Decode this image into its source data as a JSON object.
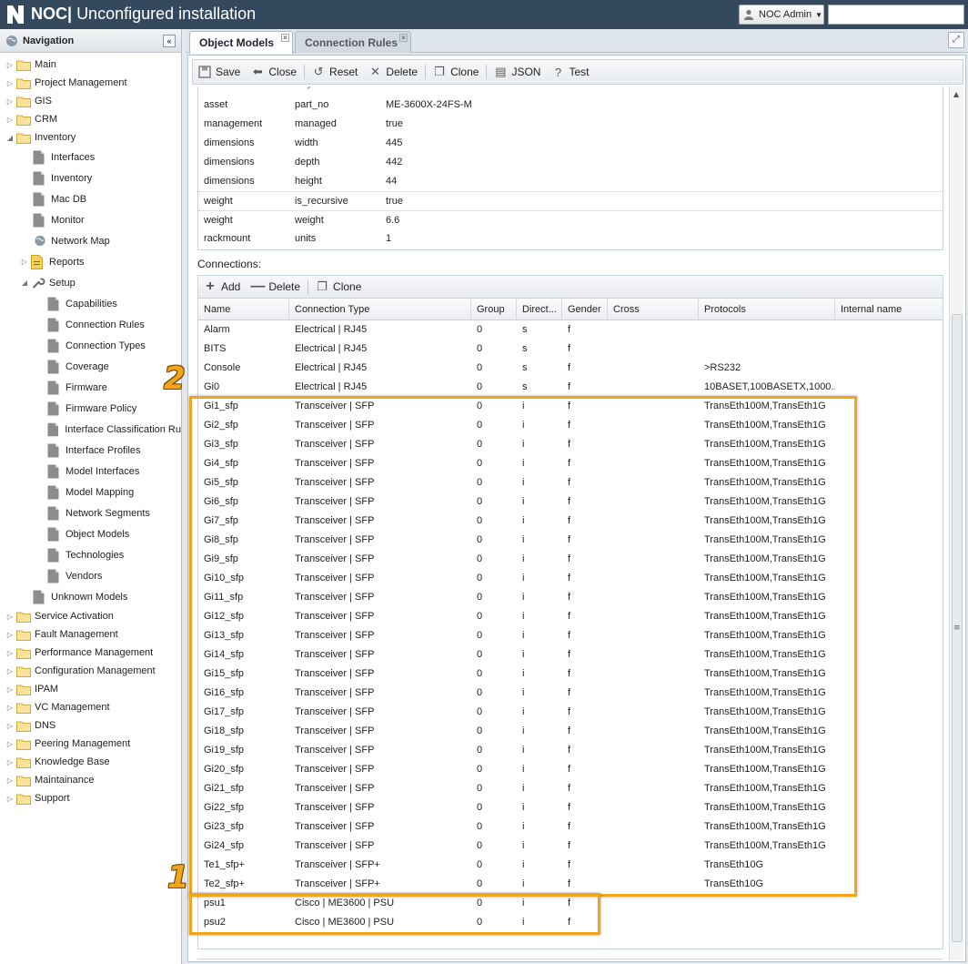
{
  "app": {
    "title_prefix": "NOC|",
    "title": "Unconfigured installation",
    "user_label": "NOC Admin",
    "search_value": ""
  },
  "navigation": {
    "header": "Navigation",
    "items": [
      {
        "label": "Main",
        "level": 0,
        "type": "folder",
        "state": "collapsed"
      },
      {
        "label": "Project Management",
        "level": 0,
        "type": "folder",
        "state": "collapsed"
      },
      {
        "label": "GIS",
        "level": 0,
        "type": "folder",
        "state": "collapsed"
      },
      {
        "label": "CRM",
        "level": 0,
        "type": "folder",
        "state": "collapsed"
      },
      {
        "label": "Inventory",
        "level": 0,
        "type": "folder",
        "state": "expanded"
      },
      {
        "label": "Interfaces",
        "level": 1,
        "type": "page"
      },
      {
        "label": "Inventory",
        "level": 1,
        "type": "page"
      },
      {
        "label": "Mac DB",
        "level": 1,
        "type": "page"
      },
      {
        "label": "Monitor",
        "level": 1,
        "type": "page"
      },
      {
        "label": "Network Map",
        "level": 1,
        "type": "globe"
      },
      {
        "label": "Reports",
        "level": 1,
        "type": "report",
        "state": "collapsed"
      },
      {
        "label": "Setup",
        "level": 1,
        "type": "wrench",
        "state": "expanded"
      },
      {
        "label": "Capabilities",
        "level": 2,
        "type": "page"
      },
      {
        "label": "Connection Rules",
        "level": 2,
        "type": "page"
      },
      {
        "label": "Connection Types",
        "level": 2,
        "type": "page"
      },
      {
        "label": "Coverage",
        "level": 2,
        "type": "page"
      },
      {
        "label": "Firmware",
        "level": 2,
        "type": "page"
      },
      {
        "label": "Firmware Policy",
        "level": 2,
        "type": "page"
      },
      {
        "label": "Interface Classification Ru",
        "level": 2,
        "type": "page"
      },
      {
        "label": "Interface Profiles",
        "level": 2,
        "type": "page"
      },
      {
        "label": "Model Interfaces",
        "level": 2,
        "type": "page"
      },
      {
        "label": "Model Mapping",
        "level": 2,
        "type": "page"
      },
      {
        "label": "Network Segments",
        "level": 2,
        "type": "page"
      },
      {
        "label": "Object Models",
        "level": 2,
        "type": "page"
      },
      {
        "label": "Technologies",
        "level": 2,
        "type": "page"
      },
      {
        "label": "Vendors",
        "level": 2,
        "type": "page"
      },
      {
        "label": "Unknown Models",
        "level": 1,
        "type": "page"
      },
      {
        "label": "Service Activation",
        "level": 0,
        "type": "folder",
        "state": "collapsed"
      },
      {
        "label": "Fault Management",
        "level": 0,
        "type": "folder",
        "state": "collapsed"
      },
      {
        "label": "Performance Management",
        "level": 0,
        "type": "folder",
        "state": "collapsed"
      },
      {
        "label": "Configuration Management",
        "level": 0,
        "type": "folder",
        "state": "collapsed"
      },
      {
        "label": "IPAM",
        "level": 0,
        "type": "folder",
        "state": "collapsed"
      },
      {
        "label": "VC Management",
        "level": 0,
        "type": "folder",
        "state": "collapsed"
      },
      {
        "label": "DNS",
        "level": 0,
        "type": "folder",
        "state": "collapsed"
      },
      {
        "label": "Peering Management",
        "level": 0,
        "type": "folder",
        "state": "collapsed"
      },
      {
        "label": "Knowledge Base",
        "level": 0,
        "type": "folder",
        "state": "collapsed"
      },
      {
        "label": "Maintainance",
        "level": 0,
        "type": "folder",
        "state": "collapsed"
      },
      {
        "label": "Support",
        "level": 0,
        "type": "folder",
        "state": "collapsed"
      }
    ]
  },
  "tabs": [
    {
      "label": "Object Models",
      "active": true
    },
    {
      "label": "Connection Rules",
      "active": false
    }
  ],
  "toolbar": {
    "save": "Save",
    "close": "Close",
    "reset": "Reset",
    "delete": "Delete",
    "clone": "Clone",
    "json": "JSON",
    "test": "Test"
  },
  "attributes": {
    "header_cut": [
      "Interface",
      "Key",
      "Value"
    ],
    "rows": [
      [
        "asset",
        "part_no",
        "ME-3600X-24FS-M"
      ],
      [
        "management",
        "managed",
        "true"
      ],
      [
        "dimensions",
        "width",
        "445"
      ],
      [
        "dimensions",
        "depth",
        "442"
      ],
      [
        "dimensions",
        "height",
        "44"
      ],
      [
        "weight",
        "is_recursive",
        "true"
      ],
      [
        "weight",
        "weight",
        "6.6"
      ],
      [
        "rackmount",
        "units",
        "1"
      ]
    ]
  },
  "connections": {
    "label": "Connections:",
    "toolbar": {
      "add": "Add",
      "delete": "Delete",
      "clone": "Clone"
    },
    "columns": [
      "Name",
      "Connection Type",
      "Group",
      "Direct...",
      "Gender",
      "Cross",
      "Protocols",
      "Internal name"
    ],
    "rows": [
      [
        "Alarm",
        "Electrical | RJ45",
        "0",
        "s",
        "f",
        "",
        "",
        ""
      ],
      [
        "BITS",
        "Electrical | RJ45",
        "0",
        "s",
        "f",
        "",
        "",
        ""
      ],
      [
        "Console",
        "Electrical | RJ45",
        "0",
        "s",
        "f",
        "",
        ">RS232",
        ""
      ],
      [
        "Gi0",
        "Electrical | RJ45",
        "0",
        "s",
        "f",
        "",
        "10BASET,100BASETX,1000...",
        ""
      ],
      [
        "Gi1_sfp",
        "Transceiver | SFP",
        "0",
        "i",
        "f",
        "",
        "TransEth100M,TransEth1G",
        ""
      ],
      [
        "Gi2_sfp",
        "Transceiver | SFP",
        "0",
        "i",
        "f",
        "",
        "TransEth100M,TransEth1G",
        ""
      ],
      [
        "Gi3_sfp",
        "Transceiver | SFP",
        "0",
        "i",
        "f",
        "",
        "TransEth100M,TransEth1G",
        ""
      ],
      [
        "Gi4_sfp",
        "Transceiver | SFP",
        "0",
        "i",
        "f",
        "",
        "TransEth100M,TransEth1G",
        ""
      ],
      [
        "Gi5_sfp",
        "Transceiver | SFP",
        "0",
        "i",
        "f",
        "",
        "TransEth100M,TransEth1G",
        ""
      ],
      [
        "Gi6_sfp",
        "Transceiver | SFP",
        "0",
        "i",
        "f",
        "",
        "TransEth100M,TransEth1G",
        ""
      ],
      [
        "Gi7_sfp",
        "Transceiver | SFP",
        "0",
        "i",
        "f",
        "",
        "TransEth100M,TransEth1G",
        ""
      ],
      [
        "Gi8_sfp",
        "Transceiver | SFP",
        "0",
        "i",
        "f",
        "",
        "TransEth100M,TransEth1G",
        ""
      ],
      [
        "Gi9_sfp",
        "Transceiver | SFP",
        "0",
        "i",
        "f",
        "",
        "TransEth100M,TransEth1G",
        ""
      ],
      [
        "Gi10_sfp",
        "Transceiver | SFP",
        "0",
        "i",
        "f",
        "",
        "TransEth100M,TransEth1G",
        ""
      ],
      [
        "Gi11_sfp",
        "Transceiver | SFP",
        "0",
        "i",
        "f",
        "",
        "TransEth100M,TransEth1G",
        ""
      ],
      [
        "Gi12_sfp",
        "Transceiver | SFP",
        "0",
        "i",
        "f",
        "",
        "TransEth100M,TransEth1G",
        ""
      ],
      [
        "Gi13_sfp",
        "Transceiver | SFP",
        "0",
        "i",
        "f",
        "",
        "TransEth100M,TransEth1G",
        ""
      ],
      [
        "Gi14_sfp",
        "Transceiver | SFP",
        "0",
        "i",
        "f",
        "",
        "TransEth100M,TransEth1G",
        ""
      ],
      [
        "Gi15_sfp",
        "Transceiver | SFP",
        "0",
        "i",
        "f",
        "",
        "TransEth100M,TransEth1G",
        ""
      ],
      [
        "Gi16_sfp",
        "Transceiver | SFP",
        "0",
        "i",
        "f",
        "",
        "TransEth100M,TransEth1G",
        ""
      ],
      [
        "Gi17_sfp",
        "Transceiver | SFP",
        "0",
        "i",
        "f",
        "",
        "TransEth100M,TransEth1G",
        ""
      ],
      [
        "Gi18_sfp",
        "Transceiver | SFP",
        "0",
        "i",
        "f",
        "",
        "TransEth100M,TransEth1G",
        ""
      ],
      [
        "Gi19_sfp",
        "Transceiver | SFP",
        "0",
        "i",
        "f",
        "",
        "TransEth100M,TransEth1G",
        ""
      ],
      [
        "Gi20_sfp",
        "Transceiver | SFP",
        "0",
        "i",
        "f",
        "",
        "TransEth100M,TransEth1G",
        ""
      ],
      [
        "Gi21_sfp",
        "Transceiver | SFP",
        "0",
        "i",
        "f",
        "",
        "TransEth100M,TransEth1G",
        ""
      ],
      [
        "Gi22_sfp",
        "Transceiver | SFP",
        "0",
        "i",
        "f",
        "",
        "TransEth100M,TransEth1G",
        ""
      ],
      [
        "Gi23_sfp",
        "Transceiver | SFP",
        "0",
        "i",
        "f",
        "",
        "TransEth100M,TransEth1G",
        ""
      ],
      [
        "Gi24_sfp",
        "Transceiver | SFP",
        "0",
        "i",
        "f",
        "",
        "TransEth100M,TransEth1G",
        ""
      ],
      [
        "Te1_sfp+",
        "Transceiver | SFP+",
        "0",
        "i",
        "f",
        "",
        "TransEth10G",
        ""
      ],
      [
        "Te2_sfp+",
        "Transceiver | SFP+",
        "0",
        "i",
        "f",
        "",
        "TransEth10G",
        ""
      ],
      [
        "psu1",
        "Cisco | ME3600 | PSU",
        "0",
        "i",
        "f",
        "",
        "",
        ""
      ],
      [
        "psu2",
        "Cisco | ME3600 | PSU",
        "0",
        "i",
        "f",
        "",
        "",
        ""
      ]
    ]
  },
  "annotations": {
    "box1_label": "1",
    "box2_label": "2",
    "color": "#f2a51a"
  },
  "colors": {
    "titlebar": "#34495e",
    "highlight": "#f2a51a"
  }
}
